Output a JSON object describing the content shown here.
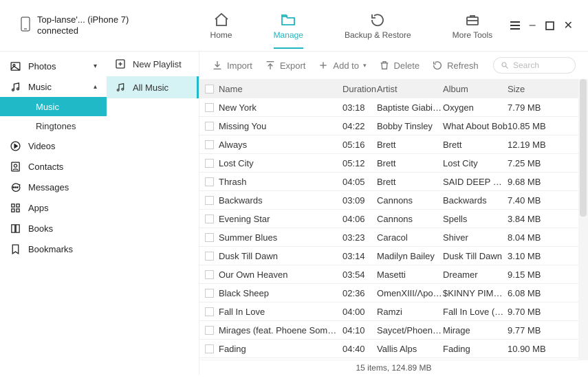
{
  "device": {
    "name": "Top-lanse'... (iPhone 7)",
    "status": "connected"
  },
  "nav": {
    "home": "Home",
    "manage": "Manage",
    "backup": "Backup & Restore",
    "tools": "More Tools"
  },
  "sidebar": {
    "photos": "Photos",
    "music": "Music",
    "sub_music": "Music",
    "sub_ringtones": "Ringtones",
    "videos": "Videos",
    "contacts": "Contacts",
    "messages": "Messages",
    "apps": "Apps",
    "books": "Books",
    "bookmarks": "Bookmarks"
  },
  "midcol": {
    "new_playlist": "New Playlist",
    "all_music": "All Music"
  },
  "toolbar": {
    "import": "Import",
    "export": "Export",
    "addto": "Add to",
    "delete": "Delete",
    "refresh": "Refresh",
    "search_placeholder": "Search"
  },
  "columns": {
    "name": "Name",
    "duration": "Duration",
    "artist": "Artist",
    "album": "Album",
    "size": "Size"
  },
  "rows": [
    {
      "name": "New York",
      "dur": "03:18",
      "artist": "Baptiste Giabiconi",
      "album": "Oxygen",
      "size": "7.79 MB"
    },
    {
      "name": "Missing You",
      "dur": "04:22",
      "artist": "Bobby Tinsley",
      "album": "What About Bob",
      "size": "10.85 MB"
    },
    {
      "name": "Always",
      "dur": "05:16",
      "artist": "Brett",
      "album": "Brett",
      "size": "12.19 MB"
    },
    {
      "name": "Lost City",
      "dur": "05:12",
      "artist": "Brett",
      "album": "Lost City",
      "size": "7.25 MB"
    },
    {
      "name": "Thrash",
      "dur": "04:05",
      "artist": "Brett",
      "album": "SAID DEEP MIXTAP...",
      "size": "9.68 MB"
    },
    {
      "name": "Backwards",
      "dur": "03:09",
      "artist": "Cannons",
      "album": "Backwards",
      "size": "7.40 MB"
    },
    {
      "name": "Evening Star",
      "dur": "04:06",
      "artist": "Cannons",
      "album": "Spells",
      "size": "3.84 MB"
    },
    {
      "name": "Summer Blues",
      "dur": "03:23",
      "artist": "Caracol",
      "album": "Shiver",
      "size": "8.04 MB"
    },
    {
      "name": "Dusk Till Dawn",
      "dur": "03:14",
      "artist": "Madilyn Bailey",
      "album": "Dusk Till Dawn",
      "size": "3.10 MB"
    },
    {
      "name": "Our Own Heaven",
      "dur": "03:54",
      "artist": "Masetti",
      "album": "Dreamer",
      "size": "9.15 MB"
    },
    {
      "name": "Black Sheep",
      "dur": "02:36",
      "artist": "OmenXIII/Λpoqou",
      "album": "$KINNY PIMPIN",
      "size": "6.08 MB"
    },
    {
      "name": "Fall In Love",
      "dur": "04:00",
      "artist": "Ramzi",
      "album": "Fall In Love (Radio...",
      "size": "9.70 MB"
    },
    {
      "name": "Mirages (feat. Phoene Somsavath)",
      "dur": "04:10",
      "artist": "Saycet/Phoene Som...",
      "album": "Mirage",
      "size": "9.77 MB"
    },
    {
      "name": "Fading",
      "dur": "04:40",
      "artist": "Vallis Alps",
      "album": "Fading",
      "size": "10.90 MB"
    }
  ],
  "status": "15 items, 124.89 MB"
}
